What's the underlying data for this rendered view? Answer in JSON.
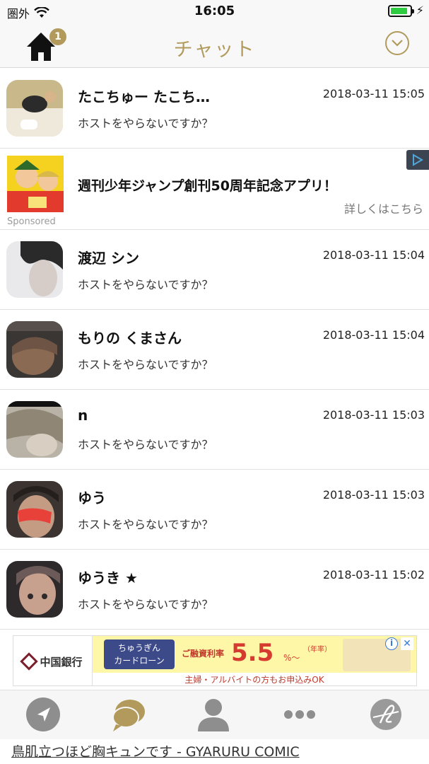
{
  "status_bar": {
    "carrier": "圏外",
    "time": "16:05",
    "battery_level": 0.9,
    "battery_color": "#2ecc40"
  },
  "nav": {
    "title": "チャット",
    "home_icon": "home-icon",
    "badge_count": "1",
    "dropdown_icon": "chevron-down-circle-icon",
    "accent_color": "#b19a5c"
  },
  "chats": [
    {
      "name": "たこちゅー たこち…",
      "time": "2018-03-11 15:05",
      "message": "ホストをやらないですか？"
    },
    {
      "name": "渡辺 シン",
      "time": "2018-03-11 15:04",
      "message": "ホストをやらないですか？"
    },
    {
      "name": "もりの くまさん",
      "time": "2018-03-11 15:04",
      "message": "ホストをやらないですか？"
    },
    {
      "name": "n",
      "time": "2018-03-11 15:03",
      "message": "ホストをやらないですか？"
    },
    {
      "name": "ゆう",
      "time": "2018-03-11 15:03",
      "message": "ホストをやらないですか？"
    },
    {
      "name": "ゆうき ★",
      "time": "2018-03-11 15:02",
      "message": "ホストをやらないですか？"
    }
  ],
  "sponsored": {
    "title": "週刊少年ジャンプ創刊50周年記念アプリ！",
    "cta": "詳しくはこちら",
    "label": "Sponsored"
  },
  "banner_ad": {
    "bank_name": "中国銀行",
    "product_line1": "ちゅうぎん",
    "product_line2": "カードローン",
    "rate_label": "ご融資利率",
    "rate_value": "5.5",
    "rate_unit": "%～",
    "rate_note": "（年率）",
    "subtext": "主婦・アルバイトの方もお申込みOK",
    "info_icon": "info-icon",
    "close_icon": "close-icon"
  },
  "tab_bar": {
    "tabs": [
      "location-arrow-icon",
      "chat-bubbles-icon",
      "person-icon",
      "more-dots-icon",
      "brand-logo-icon"
    ],
    "active_color": "#b19a5c",
    "inactive_color": "#8e8e8e"
  },
  "bottom_link": "鳥肌立つほど胸キュンです - GYARURU COMIC"
}
